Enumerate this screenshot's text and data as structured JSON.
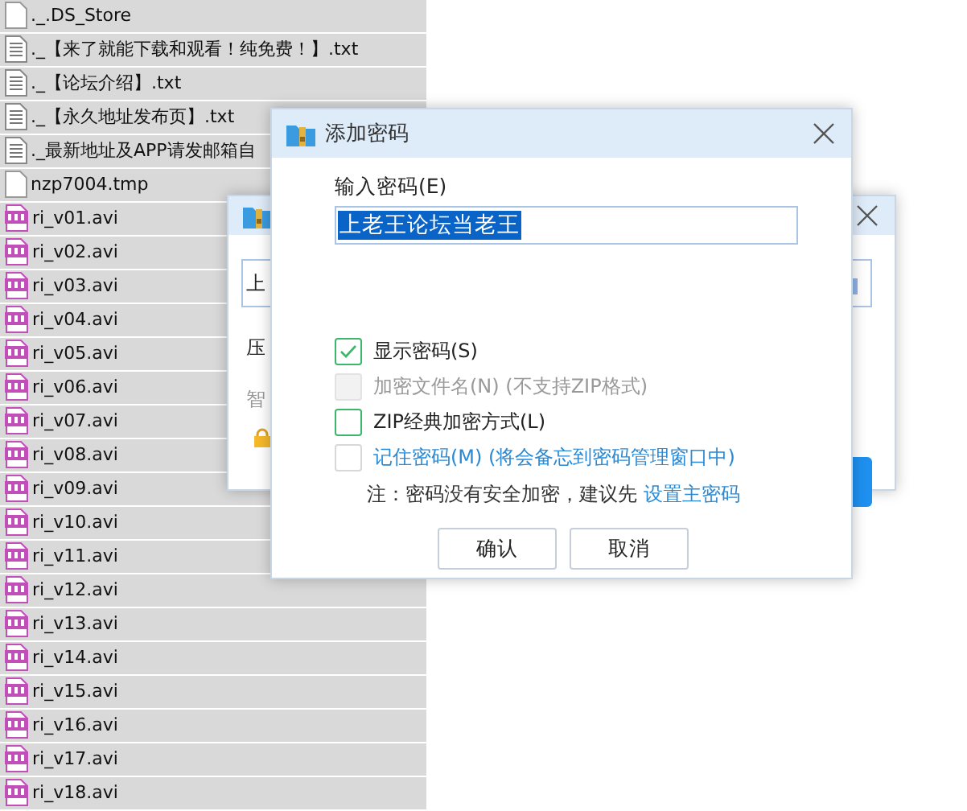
{
  "files": [
    {
      "name": "._.DS_Store",
      "kind": "blank"
    },
    {
      "name": "._【来了就能下载和观看！纯免费！】.txt",
      "kind": "text"
    },
    {
      "name": "._【论坛介绍】.txt",
      "kind": "text"
    },
    {
      "name": "._【永久地址发布页】.txt",
      "kind": "text"
    },
    {
      "name": "._最新地址及APP请发邮箱自",
      "kind": "text"
    },
    {
      "name": "nzp7004.tmp",
      "kind": "blank"
    },
    {
      "name": "ri_v01.avi",
      "kind": "video"
    },
    {
      "name": "ri_v02.avi",
      "kind": "video"
    },
    {
      "name": "ri_v03.avi",
      "kind": "video"
    },
    {
      "name": "ri_v04.avi",
      "kind": "video"
    },
    {
      "name": "ri_v05.avi",
      "kind": "video"
    },
    {
      "name": "ri_v06.avi",
      "kind": "video"
    },
    {
      "name": "ri_v07.avi",
      "kind": "video"
    },
    {
      "name": "ri_v08.avi",
      "kind": "video"
    },
    {
      "name": "ri_v09.avi",
      "kind": "video"
    },
    {
      "name": "ri_v10.avi",
      "kind": "video"
    },
    {
      "name": "ri_v11.avi",
      "kind": "video"
    },
    {
      "name": "ri_v12.avi",
      "kind": "video"
    },
    {
      "name": "ri_v13.avi",
      "kind": "video"
    },
    {
      "name": "ri_v14.avi",
      "kind": "video"
    },
    {
      "name": "ri_v15.avi",
      "kind": "video"
    },
    {
      "name": "ri_v16.avi",
      "kind": "video"
    },
    {
      "name": "ri_v17.avi",
      "kind": "video"
    },
    {
      "name": "ri_v18.avi",
      "kind": "video"
    }
  ],
  "back_dialog": {
    "field_value": "上",
    "label_1": "压",
    "label_2": "智"
  },
  "dialog": {
    "title": "添加密码",
    "field_label": "输入密码(E)",
    "field_value": "上老王论坛当老王",
    "options": [
      {
        "label": "显示密码(S)",
        "checked": true,
        "disabled": false,
        "kind": "option"
      },
      {
        "label": "加密文件名(N) (不支持ZIP格式)",
        "checked": false,
        "disabled": true,
        "kind": "option"
      },
      {
        "label": "ZIP经典加密方式(L)",
        "checked": false,
        "disabled": false,
        "kind": "option"
      },
      {
        "label": "记住密码(M) (将会备忘到密码管理窗口中)",
        "checked": false,
        "disabled": false,
        "kind": "link"
      }
    ],
    "note": "注：密码没有安全加密，建议先",
    "note_link": "设置主密码",
    "buttons": [
      "确认",
      "取消"
    ]
  }
}
